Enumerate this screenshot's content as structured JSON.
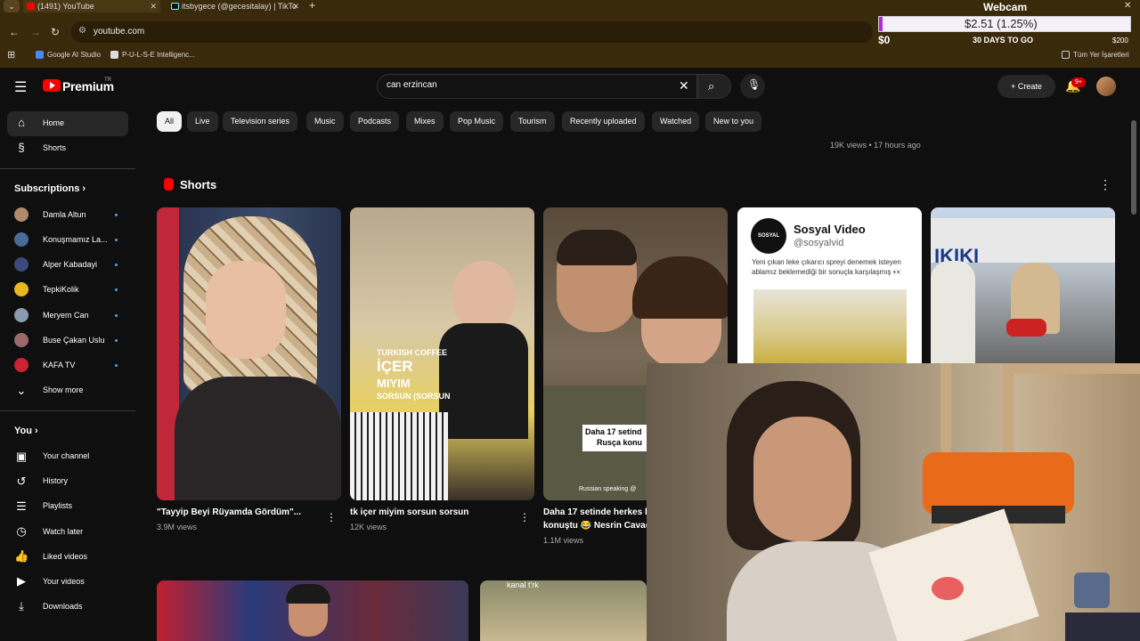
{
  "browser": {
    "tabs": [
      {
        "title": "(1491) YouTube"
      },
      {
        "title": "itsbygece (@gecesitalay) | TikTo"
      }
    ],
    "url": "youtube.com",
    "bookmarks": [
      "Google AI Studio",
      "P-U-L-S-E Intelligenc...",
      "Tüm Yer İşaretleri"
    ]
  },
  "overlay": {
    "title": "Webcam",
    "amount": "$2.51 (1.25%)",
    "progress": 0.0125,
    "min": "$0",
    "days": "30 DAYS TO GO",
    "max": "$200"
  },
  "header": {
    "brand": "Premium",
    "region": "TR",
    "search_value": "can erzincan",
    "create_label": "Create",
    "notif_count": "9+"
  },
  "chips": [
    "All",
    "Live",
    "Television series",
    "Music",
    "Podcasts",
    "Mixes",
    "Pop Music",
    "Tourism",
    "Recently uploaded",
    "Watched",
    "New to you"
  ],
  "sidebar": {
    "main": [
      {
        "label": "Home",
        "icon": "home-icon"
      },
      {
        "label": "Shorts",
        "icon": "shorts-icon"
      }
    ],
    "subscriptions_title": "Subscriptions",
    "subscriptions": [
      {
        "label": "Damla Altun",
        "color": "#b08a6a"
      },
      {
        "label": "Konuşmamız La...",
        "color": "#4a6a9a"
      },
      {
        "label": "Alper Kabadayi",
        "color": "#3a4a7a"
      },
      {
        "label": "TepkiKolik",
        "color": "#e8b820"
      },
      {
        "label": "Meryem Can",
        "color": "#8a9ab0"
      },
      {
        "label": "Buse Çakan Uslu",
        "color": "#9a6a6a"
      },
      {
        "label": "KAFA TV",
        "color": "#cc2233"
      }
    ],
    "show_more": "Show more",
    "you_title": "You",
    "you_items": [
      {
        "label": "Your channel",
        "icon": "channel-icon"
      },
      {
        "label": "History",
        "icon": "history-icon"
      },
      {
        "label": "Playlists",
        "icon": "playlists-icon"
      },
      {
        "label": "Watch later",
        "icon": "watch-later-icon"
      },
      {
        "label": "Liked videos",
        "icon": "liked-icon"
      },
      {
        "label": "Your videos",
        "icon": "your-videos-icon"
      },
      {
        "label": "Downloads",
        "icon": "downloads-icon"
      }
    ]
  },
  "main": {
    "top_meta": "19K views • 17 hours ago",
    "shorts_title": "Shorts",
    "shorts": [
      {
        "title": "\"Tayyip Beyi Rüyamda Gördüm\"...",
        "views": "3.9M views"
      },
      {
        "title": "tk içer miyim sorsun sorsun",
        "views": "12K views",
        "overlay_1": "TURKISH COFFEE",
        "overlay_2": "İÇER",
        "overlay_3": "MIYIM",
        "overlay_4": "SORSUN (SORSUN"
      },
      {
        "title": "Daha 17 setinde herkes b",
        "title2": "konuştu 😂 Nesrin Cavad",
        "views": "1.1M views",
        "overlay_1": "Daha 17 setind",
        "overlay_2": "Rusça konu",
        "overlay_3": "Russian speaking @"
      },
      {
        "card_name": "Sosyal Video",
        "card_handle": "@sosyalvid",
        "card_text": "Yeni çıkan leke çıkarıcı spreyi denemek isteyen ablamız beklemediği bir sonuçla karşılaşmış 👀",
        "card_logo": "SOSYAL VIDEO"
      },
      {
        "sign": "IKIKI"
      }
    ],
    "bottom_caption": "kanal t'rk"
  }
}
